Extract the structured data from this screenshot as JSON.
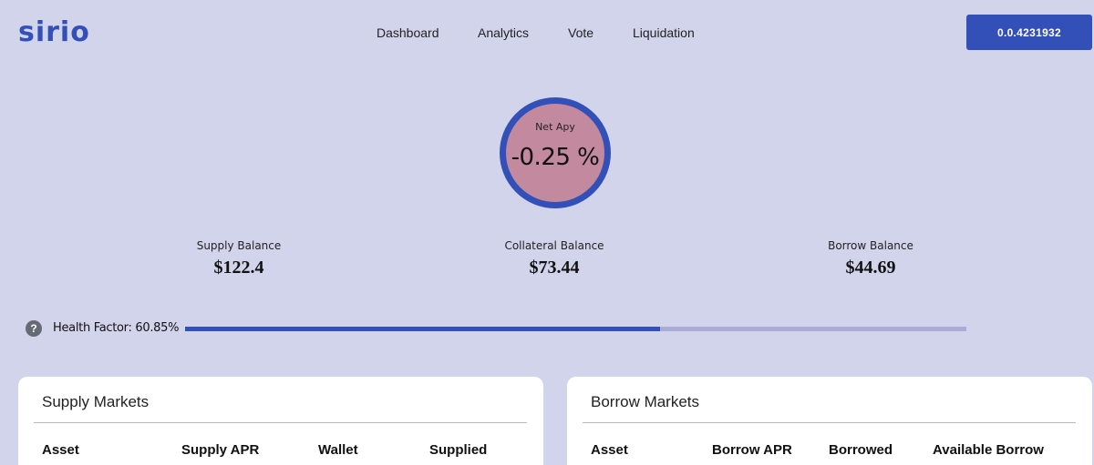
{
  "brand": {
    "logo": "sirio"
  },
  "nav": {
    "items": [
      "Dashboard",
      "Analytics",
      "Vote",
      "Liquidation"
    ]
  },
  "account": {
    "id": "0.0.4231932"
  },
  "net_apy": {
    "label": "Net Apy",
    "value": "-0.25 %"
  },
  "balances": {
    "supply": {
      "label": "Supply Balance",
      "value": "$122.4"
    },
    "collateral": {
      "label": "Collateral Balance",
      "value": "$73.44"
    },
    "borrow": {
      "label": "Borrow Balance",
      "value": "$44.69"
    }
  },
  "health": {
    "help_glyph": "?",
    "text": "Health Factor: 60.85%",
    "percent": 60.85
  },
  "supply_markets": {
    "title": "Supply Markets",
    "columns": [
      "Asset",
      "Supply APR",
      "Wallet",
      "Supplied"
    ]
  },
  "borrow_markets": {
    "title": "Borrow Markets",
    "columns": [
      "Asset",
      "Borrow APR",
      "Borrowed",
      "Available Borrow"
    ]
  },
  "colors": {
    "accent": "#3350b8",
    "background": "#d2d4ec",
    "apy_fill": "#c2899f",
    "track": "#a8acd6"
  }
}
